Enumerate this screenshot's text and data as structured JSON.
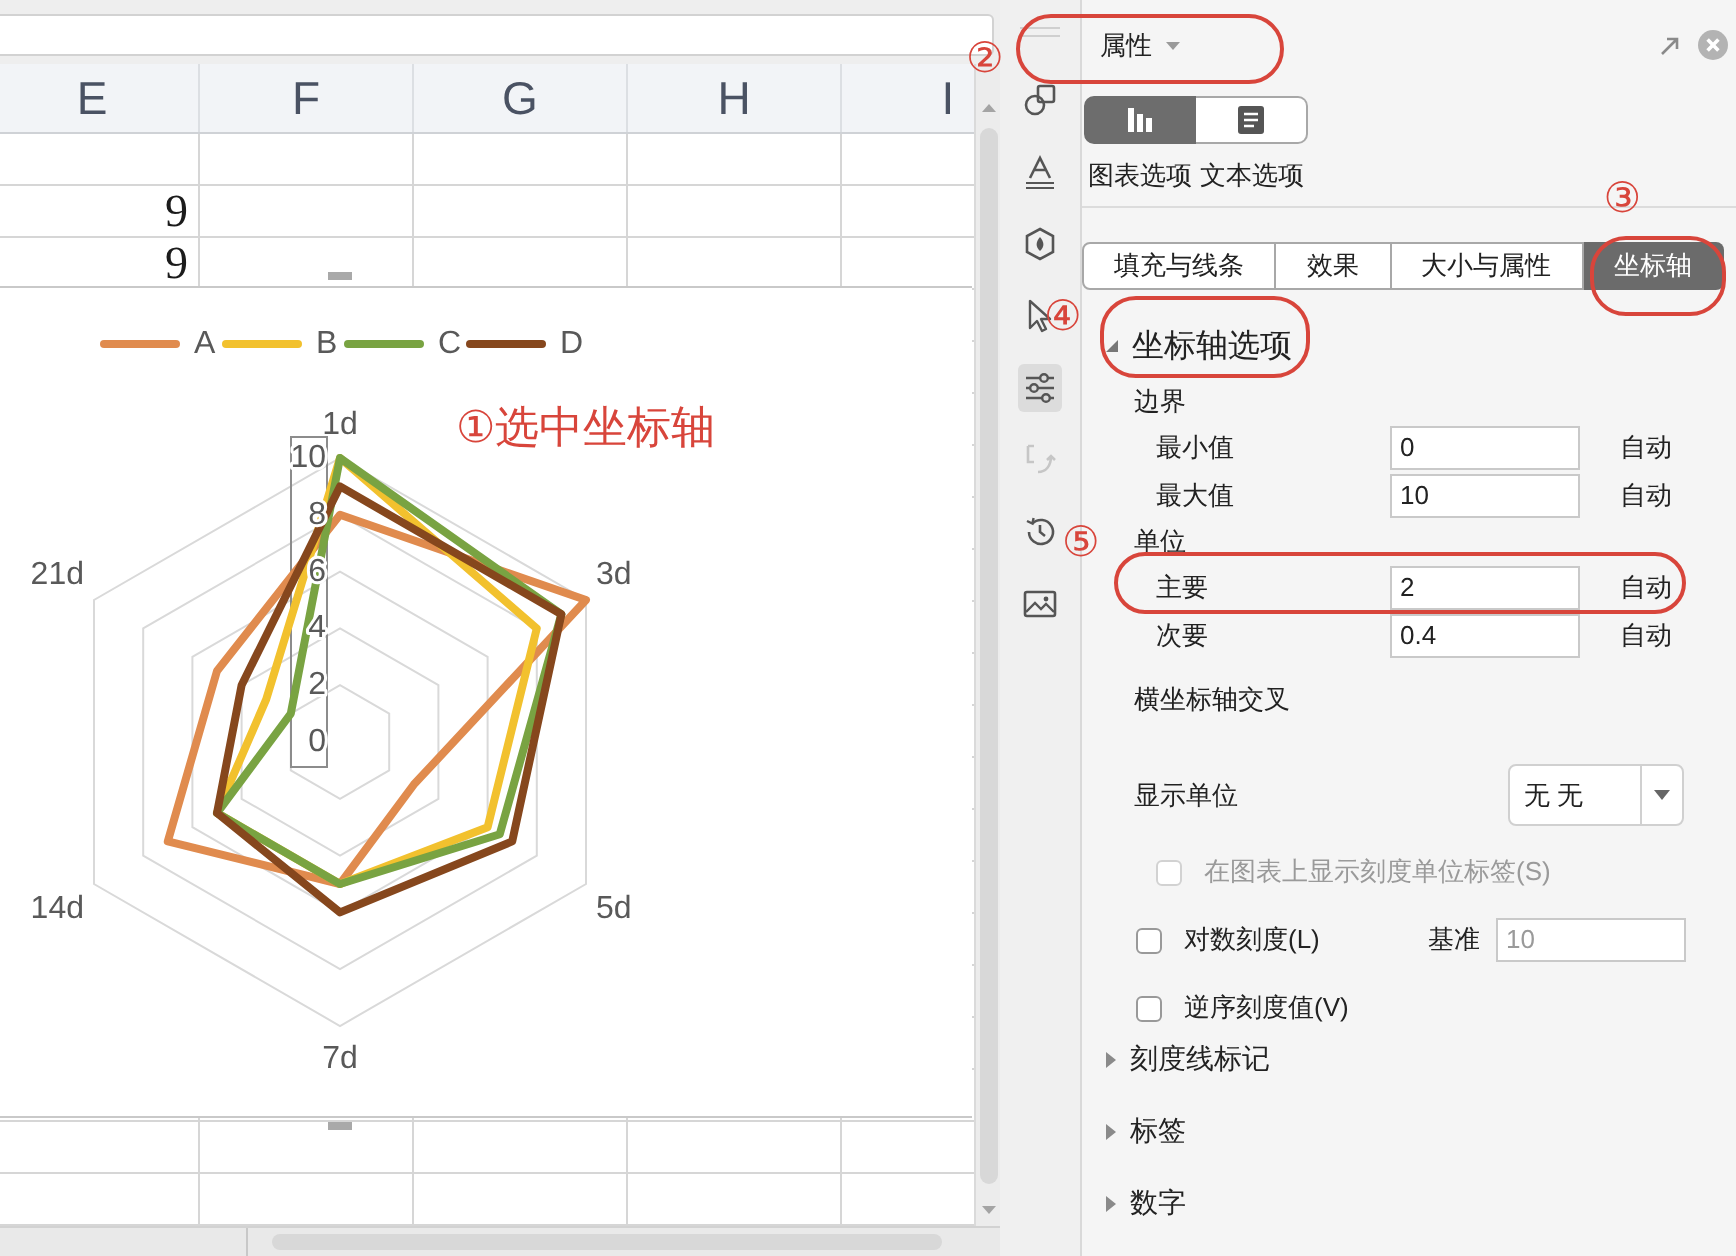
{
  "sheet": {
    "columns": [
      "E",
      "F",
      "G",
      "H",
      "I"
    ],
    "rows": [
      {
        "cells": [
          "9"
        ]
      },
      {
        "cells": [
          "9"
        ]
      }
    ],
    "chart": {
      "callout": "①选中坐标轴",
      "chart_data": {
        "type": "radar",
        "legend": "top",
        "categories": [
          "1d",
          "3d",
          "5d",
          "7d",
          "14d",
          "21d"
        ],
        "series": [
          {
            "name": "A",
            "color": "#e08b4e",
            "values": [
              8,
              10,
              3,
              5,
              7,
              5
            ]
          },
          {
            "name": "B",
            "color": "#f2c12e",
            "values": [
              10,
              8,
              6,
              5,
              5,
              3
            ]
          },
          {
            "name": "C",
            "color": "#79a342",
            "values": [
              10,
              9,
              6.5,
              5,
              5,
              2
            ]
          },
          {
            "name": "D",
            "color": "#86471d",
            "values": [
              9,
              9,
              7,
              6,
              5,
              4
            ]
          }
        ],
        "ylim": [
          0,
          10
        ],
        "yticks": [
          0,
          2,
          4,
          6,
          8,
          10
        ]
      }
    }
  },
  "side_toolbar": [
    {
      "selected": false,
      "disabled": false
    },
    {
      "selected": false,
      "disabled": false
    },
    {
      "selected": false,
      "disabled": false
    },
    {
      "selected": false,
      "disabled": false
    },
    {
      "selected": true,
      "disabled": false
    },
    {
      "selected": false,
      "disabled": true
    },
    {
      "selected": false,
      "disabled": false
    },
    {
      "selected": false,
      "disabled": false
    }
  ],
  "panel": {
    "header": {
      "title": "属性",
      "highlighted": true,
      "callout": "②"
    },
    "modes": [
      {
        "label": "图表选项",
        "selected": true
      },
      {
        "label": "文本选项",
        "selected": false
      }
    ],
    "tabs": [
      {
        "label": "填充与线条",
        "selected": false,
        "highlighted": false
      },
      {
        "label": "效果",
        "selected": false,
        "highlighted": false
      },
      {
        "label": "大小与属性",
        "selected": false,
        "highlighted": false
      },
      {
        "label": "坐标轴",
        "selected": true,
        "highlighted": true,
        "callout": "③"
      }
    ],
    "sections": [
      {
        "title": "坐标轴选项",
        "expanded": true,
        "highlighted": true,
        "callout": "④",
        "items": [
          {
            "kind": "heading",
            "text": "边界"
          },
          {
            "kind": "field",
            "label": "最小值",
            "value": "0",
            "reset": "自动",
            "highlighted": false
          },
          {
            "kind": "field",
            "label": "最大值",
            "value": "10",
            "reset": "自动",
            "highlighted": false
          },
          {
            "kind": "heading",
            "text": "单位"
          },
          {
            "kind": "field",
            "label": "主要",
            "value": "2",
            "reset": "自动",
            "highlighted": true,
            "callout": "⑤"
          },
          {
            "kind": "field",
            "label": "次要",
            "value": "0.4",
            "reset": "自动",
            "highlighted": false
          },
          {
            "kind": "heading",
            "text": "横坐标轴交叉"
          },
          {
            "kind": "dropdown",
            "label": "显示单位",
            "value": "无 无"
          },
          {
            "kind": "checkbox",
            "label": "在图表上显示刻度单位标签(S)",
            "checked": false,
            "disabled": true
          },
          {
            "kind": "checkbox",
            "label": "对数刻度(L)",
            "checked": false,
            "disabled": false,
            "field": {
              "label": "基准",
              "value": "10",
              "disabled": true
            }
          },
          {
            "kind": "checkbox",
            "label": "逆序刻度值(V)",
            "checked": false,
            "disabled": false
          }
        ]
      },
      {
        "title": "刻度线标记",
        "expanded": false,
        "highlighted": false
      },
      {
        "title": "标签",
        "expanded": false,
        "highlighted": false
      },
      {
        "title": "数字",
        "expanded": false,
        "highlighted": false
      }
    ]
  }
}
